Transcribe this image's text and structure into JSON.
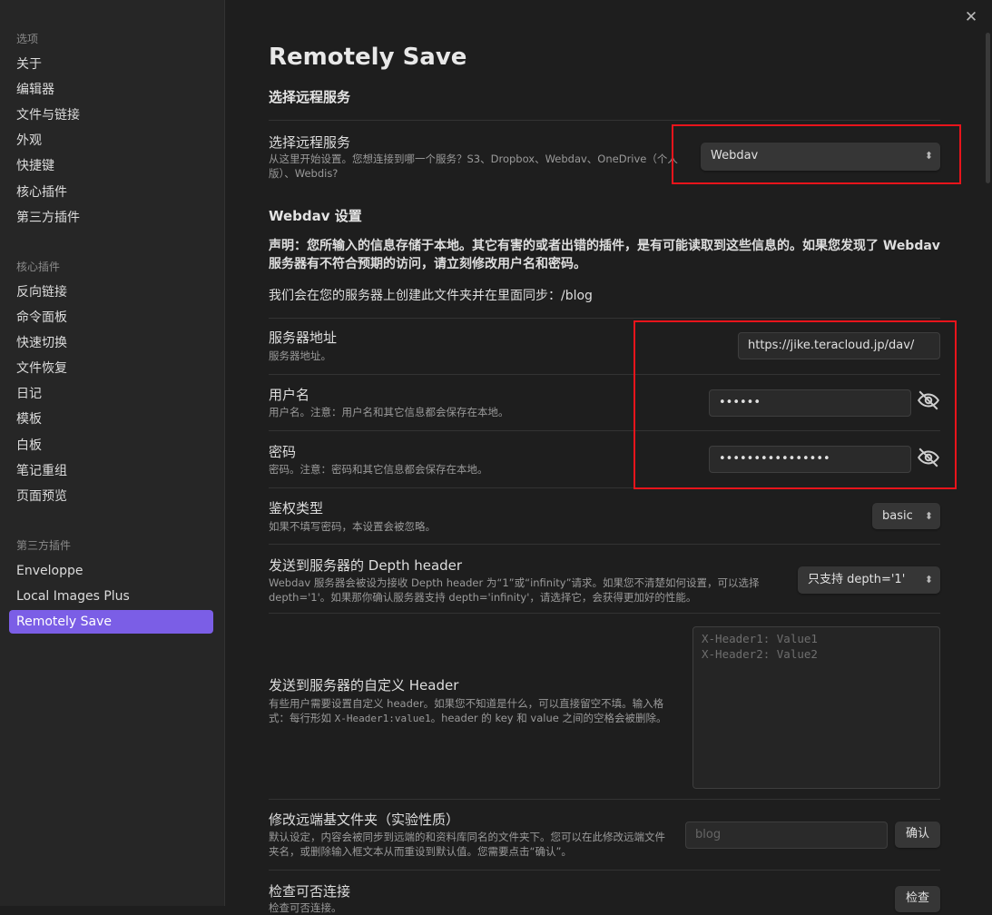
{
  "sidebar": {
    "group_options": "选项",
    "options": [
      "关于",
      "编辑器",
      "文件与链接",
      "外观",
      "快捷键",
      "核心插件",
      "第三方插件"
    ],
    "group_core": "核心插件",
    "core": [
      "反向链接",
      "命令面板",
      "快速切换",
      "文件恢复",
      "日记",
      "模板",
      "白板",
      "笔记重组",
      "页面预览"
    ],
    "group_third": "第三方插件",
    "third": [
      "Enveloppe",
      "Local Images Plus",
      "Remotely Save"
    ]
  },
  "main": {
    "title": "Remotely Save",
    "section_remote": "选择远程服务",
    "service": {
      "name": "选择远程服务",
      "desc": "从这里开始设置。您想连接到哪一个服务？S3、Dropbox、Webdav、OneDrive（个人版）、Webdis?",
      "value": "Webdav"
    },
    "webdav_heading": "Webdav 设置",
    "notice": "声明：您所输入的信息存储于本地。其它有害的或者出错的插件，是有可能读取到这些信息的。如果您发现了 Webdav 服务器有不符合预期的访问，请立刻修改用户名和密码。",
    "folder_info": "我们会在您的服务器上创建此文件夹并在里面同步：/blog",
    "server": {
      "name": "服务器地址",
      "desc": "服务器地址。",
      "value": "https://jike.teracloud.jp/dav/"
    },
    "username": {
      "name": "用户名",
      "desc": "用户名。注意：用户名和其它信息都会保存在本地。",
      "value": "••••••"
    },
    "password": {
      "name": "密码",
      "desc": "密码。注意：密码和其它信息都会保存在本地。",
      "value": "••••••••••••••••"
    },
    "auth": {
      "name": "鉴权类型",
      "desc": "如果不填写密码，本设置会被忽略。",
      "value": "basic"
    },
    "depth": {
      "name": "发送到服务器的 Depth header",
      "desc": "Webdav 服务器会被设为接收 Depth header 为“1”或“infinity”请求。如果您不清楚如何设置，可以选择 depth='1'。如果那你确认服务器支持 depth='infinity'，请选择它，会获得更加好的性能。",
      "value": "只支持 depth='1'"
    },
    "custom_header": {
      "name": "发送到服务器的自定义 Header",
      "desc_a": "有些用户需要设置自定义 header。如果您不知道是什么，可以直接留空不填。输入格式：每行形如 ",
      "desc_code": "X-Header1:value1",
      "desc_b": "。header 的 key 和 value 之间的空格会被删除。",
      "placeholder": "X-Header1: Value1\nX-Header2: Value2"
    },
    "base_dir": {
      "name": "修改远端基文件夹（实验性质）",
      "desc": "默认设定，内容会被同步到远端的和资料库同名的文件夹下。您可以在此修改远端文件夹名，或删除输入框文本从而重设到默认值。您需要点击“确认”。",
      "placeholder": "blog",
      "button": "确认"
    },
    "check": {
      "name": "检查可否连接",
      "desc": "检查可否连接。",
      "button": "检查"
    }
  },
  "colors": {
    "accent": "#7b5ee6",
    "highlight_box": "#e8141b"
  }
}
